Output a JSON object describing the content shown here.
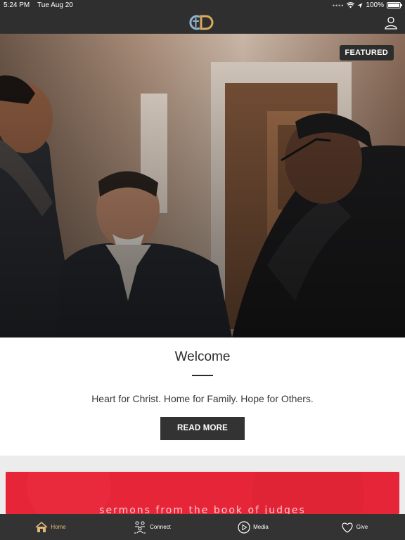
{
  "status_bar": {
    "time": "5:24 PM",
    "date": "Tue Aug 20",
    "battery": "100%",
    "battery_level": 1.0,
    "icons": [
      "signal-dots-icon",
      "wifi-icon",
      "location-arrow-icon",
      "battery-icon"
    ]
  },
  "nav": {
    "logo_icon": "cross-d-logo-icon",
    "profile_icon": "user-profile-icon"
  },
  "hero": {
    "badge": "FEATURED"
  },
  "welcome": {
    "title": "Welcome",
    "tagline": "Heart for Christ. Home for Family. Hope for Others.",
    "button": "READ MORE"
  },
  "sermon_banner": {
    "text": "sermons from the book of judges",
    "color": "#ee2a3c"
  },
  "tabs": [
    {
      "label": "Home",
      "icon": "home-icon",
      "active": true
    },
    {
      "label": "Connect",
      "icon": "connect-people-icon",
      "active": false
    },
    {
      "label": "Media",
      "icon": "play-circle-icon",
      "active": false
    },
    {
      "label": "Give",
      "icon": "heart-icon",
      "active": false
    }
  ],
  "colors": {
    "bar": "#2f2f2f",
    "accent": "#e2b97a",
    "logo_blue": "#8fb1c9",
    "logo_gold": "#d9a95c"
  }
}
